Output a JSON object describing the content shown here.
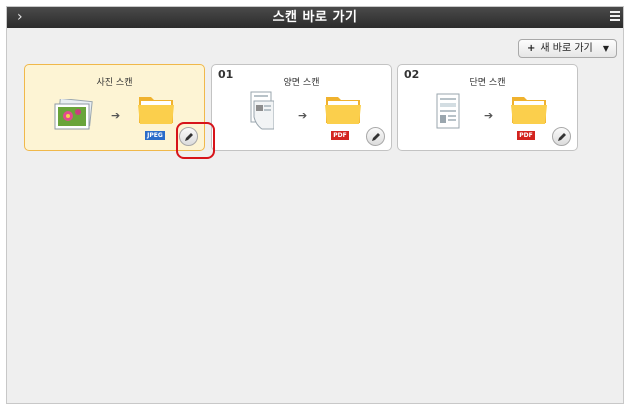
{
  "window": {
    "title": "스캔 바로 가기"
  },
  "toolbar": {
    "new_shortcut_label": "새 바로 가기"
  },
  "cards": [
    {
      "number": "",
      "name": "사진 스캔",
      "format": "JPEG",
      "selected": true
    },
    {
      "number": "01",
      "name": "양면 스캔",
      "format": "PDF",
      "selected": false
    },
    {
      "number": "02",
      "name": "단면 스캔",
      "format": "PDF",
      "selected": false
    }
  ],
  "colors": {
    "selected_card": "#fdf4d4",
    "highlight": "#d7141a",
    "pdf_tag": "#d3241f",
    "jpeg_tag": "#2a6cc9"
  }
}
